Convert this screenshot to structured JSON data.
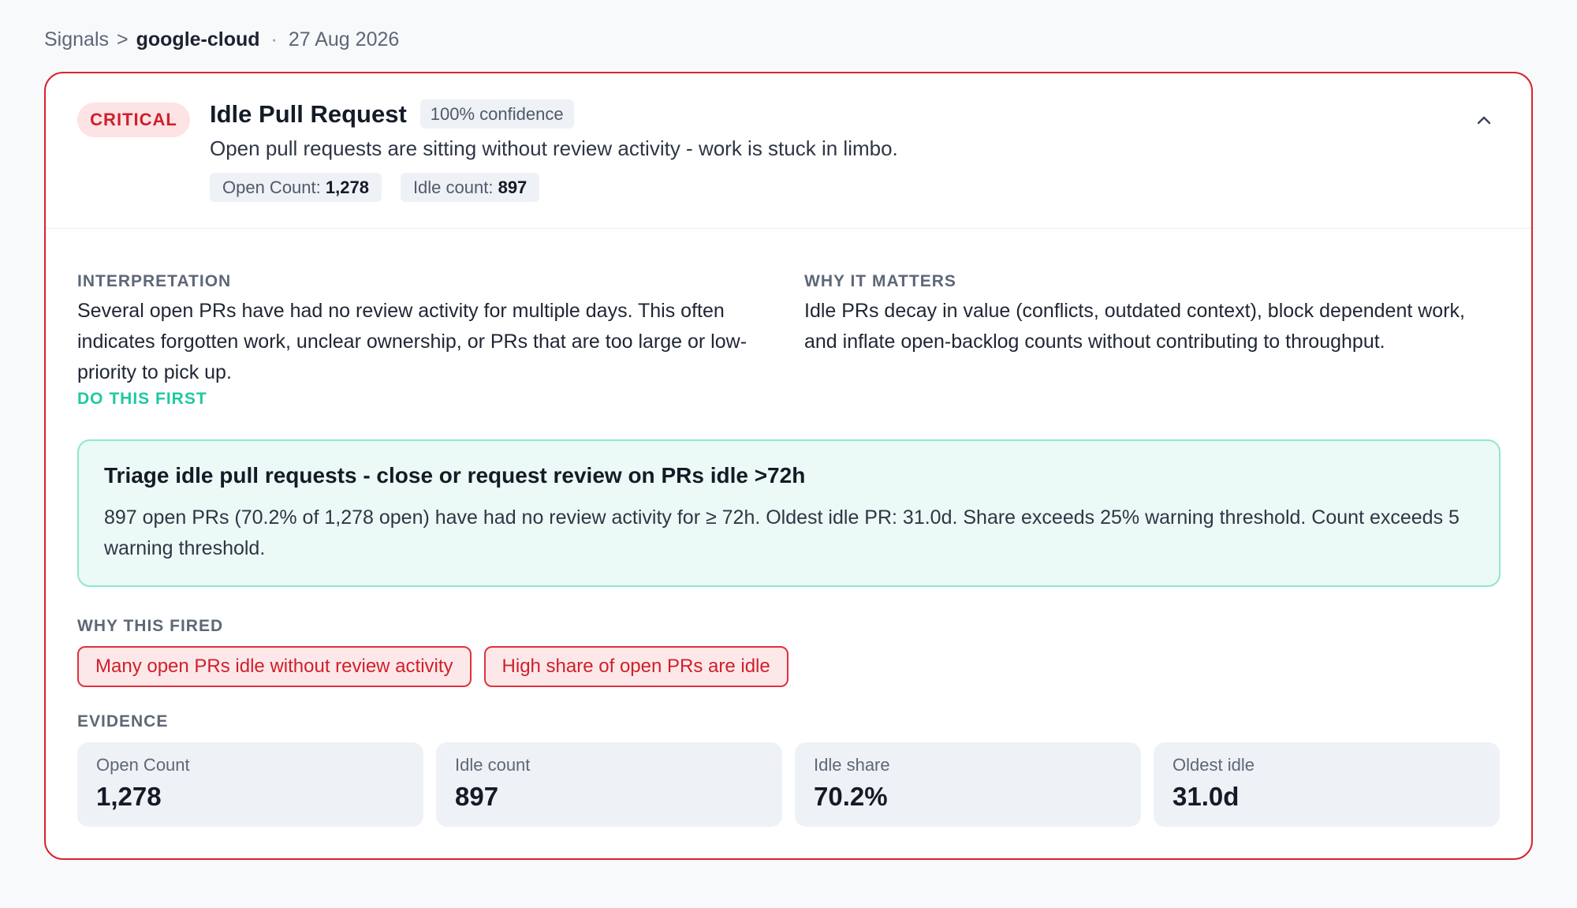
{
  "breadcrumb": {
    "root": "Signals",
    "separator": ">",
    "current": "google-cloud",
    "dot": "·",
    "date": "27 Aug 2026"
  },
  "signal": {
    "severity": "CRITICAL",
    "title": "Idle Pull Request",
    "confidence": "100% confidence",
    "description": "Open pull requests are sitting without review activity - work is stuck in limbo.",
    "metrics": [
      {
        "label": "Open Count:",
        "value": "1,278"
      },
      {
        "label": "Idle count:",
        "value": "897"
      }
    ],
    "collapse_icon": "chevron-up-icon"
  },
  "interpretation": {
    "label": "INTERPRETATION",
    "text": "Several open PRs have had no review activity for multiple days. This often indicates forgotten work, unclear ownership, or PRs that are too large or low-priority to pick up."
  },
  "why_it_matters": {
    "label": "WHY IT MATTERS",
    "text": "Idle PRs decay in value (conflicts, outdated context), block dependent work, and inflate open-backlog counts without contributing to throughput."
  },
  "do_this_first": {
    "label": "DO THIS FIRST",
    "title": "Triage idle pull requests - close or request review on PRs idle >72h",
    "body": "897 open PRs (70.2% of 1,278 open) have had no review activity for ≥ 72h. Oldest idle PR: 31.0d. Share exceeds 25% warning threshold. Count exceeds 5 warning threshold."
  },
  "why_fired": {
    "label": "WHY THIS FIRED",
    "reasons": [
      "Many open PRs idle without review activity",
      "High share of open PRs are idle"
    ]
  },
  "evidence": {
    "label": "EVIDENCE",
    "items": [
      {
        "label": "Open Count",
        "value": "1,278"
      },
      {
        "label": "Idle count",
        "value": "897"
      },
      {
        "label": "Idle share",
        "value": "70.2%"
      },
      {
        "label": "Oldest idle",
        "value": "31.0d"
      }
    ]
  },
  "colors": {
    "critical": "#d9232e",
    "accent_green": "#1fc9a1",
    "action_bg": "#ebfaf6"
  }
}
